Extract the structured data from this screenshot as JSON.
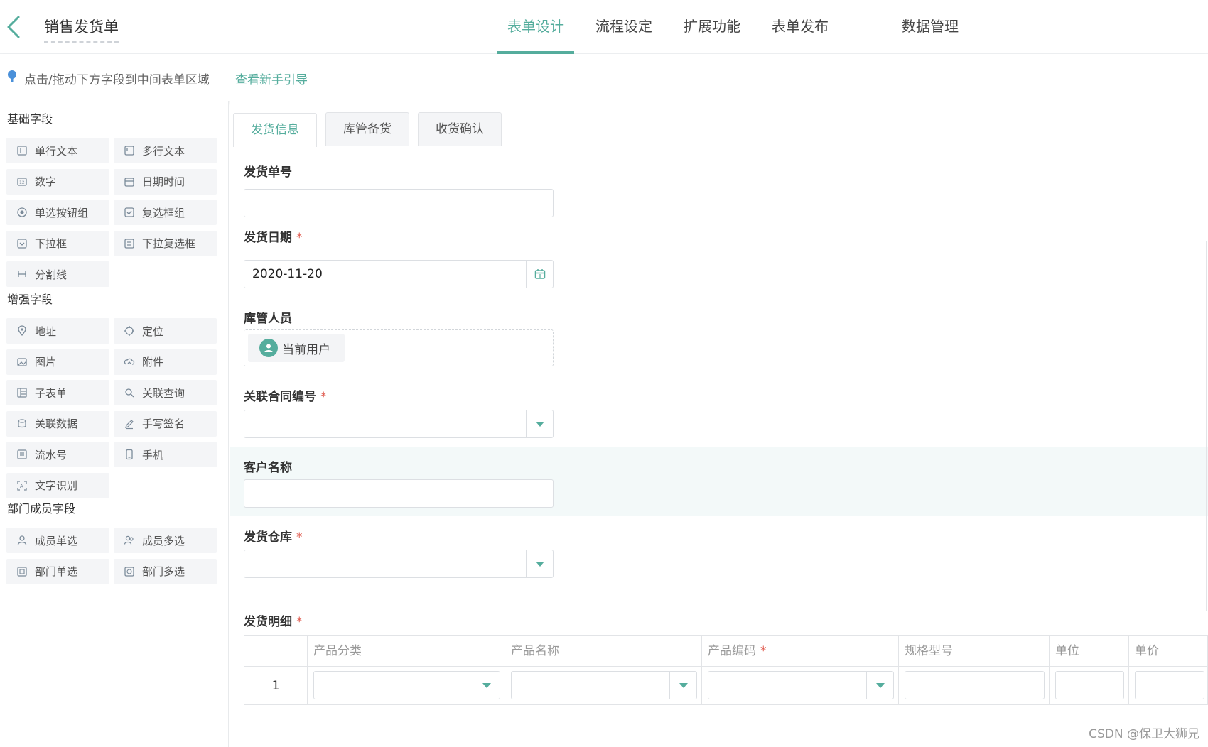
{
  "header": {
    "form_title": "销售发货单",
    "tabs": [
      "表单设计",
      "流程设定",
      "扩展功能",
      "表单发布",
      "数据管理"
    ],
    "active_tab": "表单设计",
    "accent_color": "#55ad9d"
  },
  "hint": {
    "text": "点击/拖动下方字段到中间表单区域",
    "link": "查看新手引导"
  },
  "sidebar": {
    "groups": [
      {
        "title": "基础字段",
        "items": [
          {
            "label": "单行文本",
            "icon": "single-line-text-icon"
          },
          {
            "label": "多行文本",
            "icon": "multi-line-text-icon"
          },
          {
            "label": "数字",
            "icon": "number-icon"
          },
          {
            "label": "日期时间",
            "icon": "calendar-icon"
          },
          {
            "label": "单选按钮组",
            "icon": "radio-icon"
          },
          {
            "label": "复选框组",
            "icon": "checkbox-icon"
          },
          {
            "label": "下拉框",
            "icon": "dropdown-icon"
          },
          {
            "label": "下拉复选框",
            "icon": "dropdown-checkbox-icon"
          },
          {
            "label": "分割线",
            "icon": "divider-icon"
          }
        ]
      },
      {
        "title": "增强字段",
        "items": [
          {
            "label": "地址",
            "icon": "location-pin-icon"
          },
          {
            "label": "定位",
            "icon": "crosshair-icon"
          },
          {
            "label": "图片",
            "icon": "image-icon"
          },
          {
            "label": "附件",
            "icon": "upload-cloud-icon"
          },
          {
            "label": "子表单",
            "icon": "subform-icon"
          },
          {
            "label": "关联查询",
            "icon": "search-link-icon"
          },
          {
            "label": "关联数据",
            "icon": "link-data-icon"
          },
          {
            "label": "手写签名",
            "icon": "pen-icon"
          },
          {
            "label": "流水号",
            "icon": "serial-number-icon"
          },
          {
            "label": "手机",
            "icon": "phone-icon"
          },
          {
            "label": "文字识别",
            "icon": "ocr-icon"
          }
        ]
      },
      {
        "title": "部门成员字段",
        "items": [
          {
            "label": "成员单选",
            "icon": "user-icon"
          },
          {
            "label": "成员多选",
            "icon": "users-icon"
          },
          {
            "label": "部门单选",
            "icon": "department-icon"
          },
          {
            "label": "部门多选",
            "icon": "departments-icon"
          }
        ]
      }
    ]
  },
  "form": {
    "tabs": [
      "发货信息",
      "库管备货",
      "收货确认"
    ],
    "active_tab": "发货信息",
    "fields": {
      "shipment_no": {
        "label": "发货单号",
        "value": ""
      },
      "ship_date": {
        "label": "发货日期",
        "value": "2020-11-20",
        "required": "*"
      },
      "warehouse_keeper": {
        "label": "库管人员",
        "value": "当前用户"
      },
      "contract_no": {
        "label": "关联合同编号",
        "required": "*"
      },
      "customer": {
        "label": "客户名称",
        "value": ""
      },
      "warehouse": {
        "label": "发货仓库",
        "required": "*"
      },
      "details": {
        "label": "发货明细",
        "required": "*"
      }
    },
    "table": {
      "columns": [
        {
          "label": ""
        },
        {
          "label": "产品分类",
          "required": ""
        },
        {
          "label": "产品名称",
          "required": ""
        },
        {
          "label": "产品编码",
          "required": "*"
        },
        {
          "label": "规格型号",
          "required": ""
        },
        {
          "label": "单位",
          "required": ""
        },
        {
          "label": "单价",
          "required": ""
        }
      ],
      "rows": [
        {
          "index": "1"
        }
      ]
    }
  },
  "watermark": "CSDN @保卫大狮兄"
}
